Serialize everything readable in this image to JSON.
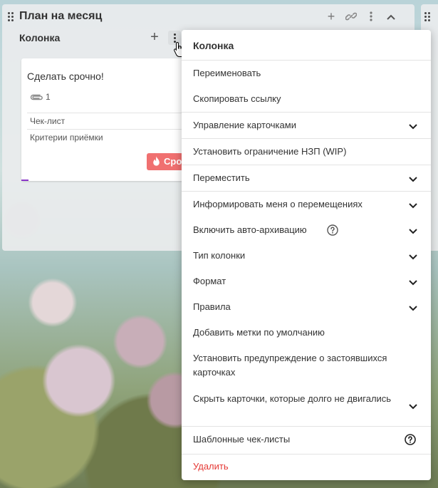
{
  "board": {
    "title": "План на месяц"
  },
  "column": {
    "title": "Колонка",
    "add_icon": "plus-icon",
    "menu_icon": "kebab-icon"
  },
  "card": {
    "title": "Сделать срочно!",
    "attachments": "1",
    "checklists": [
      {
        "label": "Чек-лист"
      },
      {
        "label": "Критерии приёмки"
      }
    ],
    "tag": "Срочно",
    "tag_color": "#f07070"
  },
  "menu": {
    "title": "Колонка",
    "items": [
      {
        "label": "Переименовать"
      },
      {
        "label": "Скопировать ссылку"
      },
      {
        "label": "Управление карточками"
      },
      {
        "label": "Установить ограничение НЗП (WIP)"
      },
      {
        "label": "Переместить"
      },
      {
        "label": "Информировать меня о перемещениях"
      },
      {
        "label": "Включить авто-архивацию"
      },
      {
        "label": "Тип колонки"
      },
      {
        "label": "Формат"
      },
      {
        "label": "Правила"
      },
      {
        "label": "Добавить метки по умолчанию"
      },
      {
        "label": "Установить предупреждение о застоявшихся карточках"
      },
      {
        "label": "Скрыть карточки, которые долго не двигались"
      },
      {
        "label": "Шаблонные чек-листы"
      },
      {
        "label": "Удалить"
      }
    ],
    "danger_color": "#e53935"
  }
}
